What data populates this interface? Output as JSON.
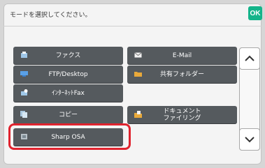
{
  "header": {
    "prompt": "モードを選択してください。",
    "ok_label": "OK"
  },
  "modes": [
    {
      "label": "ファクス",
      "icon": "fax-icon"
    },
    {
      "label": "E-Mail",
      "icon": "email-icon"
    },
    {
      "label": "FTP/Desktop",
      "icon": "ftp-desktop-icon"
    },
    {
      "label": "共有フォルダー",
      "icon": "shared-folder-icon"
    },
    {
      "label": "ｲﾝﾀｰﾈｯﾄFax",
      "icon": "internet-fax-icon"
    },
    {
      "label": "コピー",
      "icon": "copy-icon"
    },
    {
      "label": "ドキュメント\nファイリング",
      "icon": "document-filing-icon"
    },
    {
      "label": "Sharp OSA",
      "icon": "sharp-osa-icon"
    }
  ],
  "scroll": {
    "up_icon": "chevron-up-icon",
    "down_icon": "chevron-down-icon"
  },
  "colors": {
    "ok": "#14b48a",
    "highlight": "#e0232e",
    "button": "#555a5e"
  }
}
